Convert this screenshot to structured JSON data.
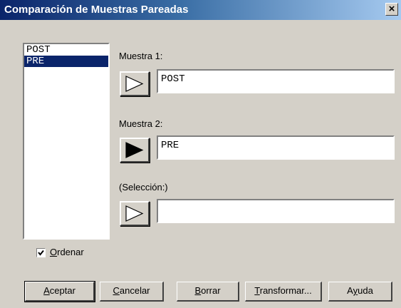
{
  "window": {
    "title": "Comparación de Muestras Pareadas",
    "close_glyph": "×"
  },
  "variables_list": {
    "items": [
      "POST",
      "PRE"
    ],
    "selected": "PRE"
  },
  "muestra1": {
    "label": "Muestra 1:",
    "value": "POST"
  },
  "muestra2": {
    "label": "Muestra 2:",
    "value": "PRE"
  },
  "seleccion": {
    "label": "(Selección:)",
    "value": ""
  },
  "ordenar": {
    "mnemonic": "O",
    "rest": "rdenar",
    "checked": true
  },
  "buttons": {
    "aceptar": {
      "mnemonic": "A",
      "rest": "ceptar"
    },
    "cancelar": {
      "mnemonic": "C",
      "rest": "ancelar"
    },
    "borrar": {
      "mnemonic": "B",
      "rest": "orrar"
    },
    "transformar": {
      "mnemonic": "T",
      "rest": "ransformar..."
    },
    "ayuda": {
      "before": "A",
      "mnemonic": "y",
      "after": "uda"
    }
  },
  "icons": {
    "arrow": "triangle-right-icon",
    "check": "check-icon"
  }
}
